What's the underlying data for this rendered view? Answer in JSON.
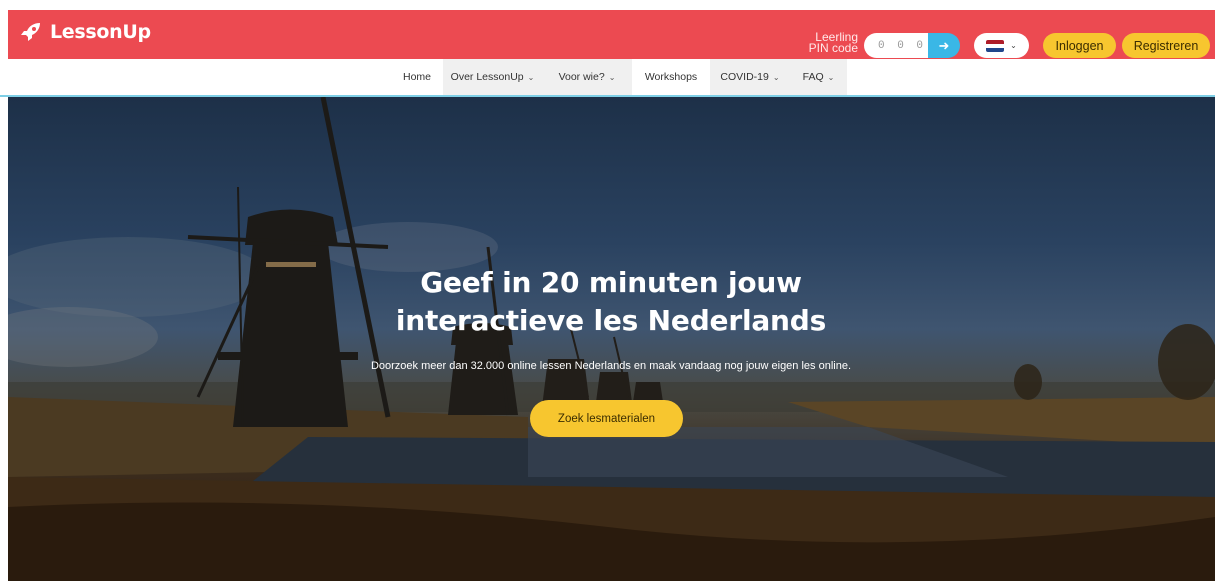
{
  "brand": {
    "name": "LessonUp",
    "icon": "rocket-icon",
    "color": "#ec4a51"
  },
  "pin": {
    "label_line1": "Leerling",
    "label_line2": "PIN code",
    "placeholder": "0 0 0 0",
    "go_icon": "arrow-right-icon"
  },
  "language": {
    "flag": "flag-nl-icon",
    "chevron": "chevron-down-icon"
  },
  "auth": {
    "login_label": "Inloggen",
    "register_label": "Registreren",
    "button_color": "#f7c62f"
  },
  "nav": {
    "items": [
      {
        "label": "Home",
        "dropdown": false
      },
      {
        "label": "Over LessonUp",
        "dropdown": true
      },
      {
        "label": "Voor wie?",
        "dropdown": true
      },
      {
        "label": "Workshops",
        "dropdown": false
      },
      {
        "label": "COVID-19",
        "dropdown": true
      },
      {
        "label": "FAQ",
        "dropdown": true
      }
    ]
  },
  "hero": {
    "title_line1": "Geef in 20 minuten jouw",
    "title_line2": "interactieve les Nederlands",
    "subtitle": "Doorzoek meer dan 32.000 online lessen Nederlands en maak vandaag nog jouw eigen les online.",
    "cta_label": "Zoek lesmaterialen"
  }
}
